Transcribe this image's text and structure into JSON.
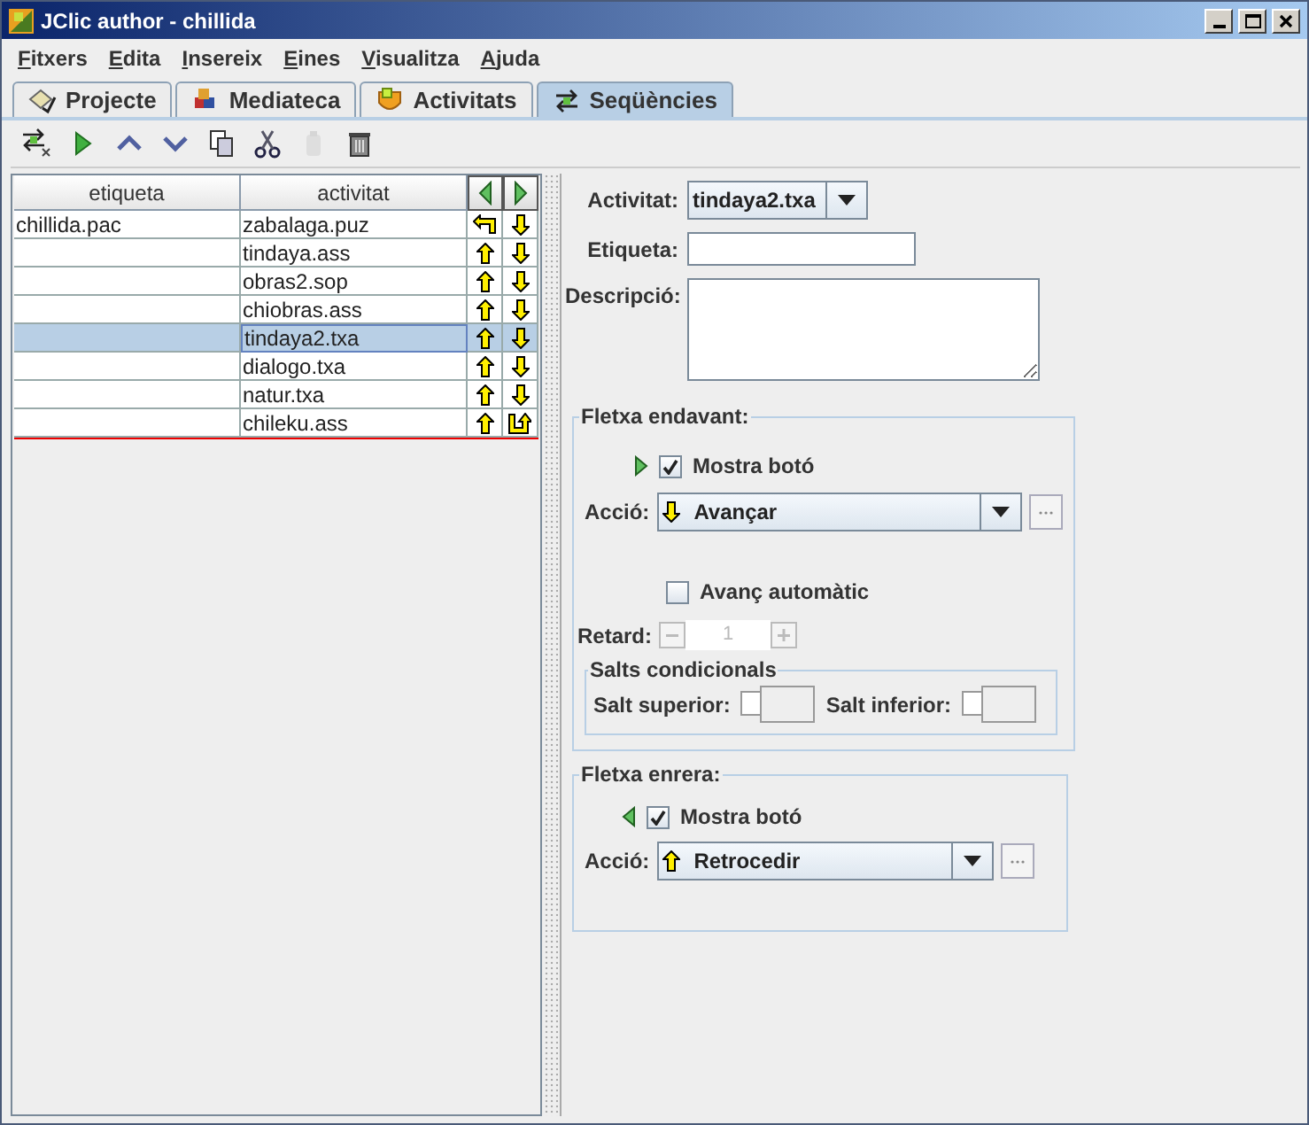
{
  "window": {
    "title": "JClic author - chillida"
  },
  "menu": [
    "Fitxers",
    "Edita",
    "Insereix",
    "Eines",
    "Visualitza",
    "Ajuda"
  ],
  "tabs": [
    {
      "label": "Projecte",
      "selected": false
    },
    {
      "label": "Mediateca",
      "selected": false
    },
    {
      "label": "Activitats",
      "selected": false
    },
    {
      "label": "Seqüències",
      "selected": true
    }
  ],
  "toolbar": [
    {
      "disabled": false
    },
    {
      "disabled": false
    },
    {
      "disabled": false
    },
    {
      "disabled": false
    },
    {
      "disabled": false
    },
    {
      "disabled": false
    },
    {
      "disabled": true
    },
    {
      "disabled": false
    }
  ],
  "table": {
    "columns": [
      "etiqueta",
      "activitat"
    ],
    "rows": [
      {
        "label": "chillida.pac",
        "activity": "zabalaga.puz",
        "back": {
          "kind": "return"
        },
        "forward": {
          "kind": "down"
        },
        "selected": false
      },
      {
        "activity": "tindaya.ass",
        "back": {
          "kind": "up"
        },
        "forward": {
          "kind": "down"
        },
        "selected": false
      },
      {
        "activity": "obras2.sop",
        "back": {
          "kind": "up"
        },
        "forward": {
          "kind": "down"
        },
        "selected": false
      },
      {
        "activity": "chiobras.ass",
        "back": {
          "kind": "up"
        },
        "forward": {
          "kind": "down"
        },
        "selected": false
      },
      {
        "activity": "tindaya2.txa",
        "back": {
          "kind": "up"
        },
        "forward": {
          "kind": "down"
        },
        "selected": true
      },
      {
        "activity": "dialogo.txa",
        "back": {
          "kind": "up"
        },
        "forward": {
          "kind": "down"
        },
        "selected": false
      },
      {
        "activity": "natur.txa",
        "back": {
          "kind": "up"
        },
        "forward": {
          "kind": "down"
        },
        "selected": false
      },
      {
        "activity": "chileku.ass",
        "back": {
          "kind": "up"
        },
        "forward": {
          "kind": "exit"
        },
        "selected": false
      }
    ]
  },
  "form": {
    "activity_label": "Activitat:",
    "activity": "tindaya2.txa",
    "tag_label": "Etiqueta:",
    "description_label": "Descripció:",
    "forward": {
      "title": "Fletxa endavant:",
      "show_label": "Mostra botó",
      "show_checked": true,
      "action_label": "Acció:",
      "action": "Avançar",
      "action_icon": {
        "kind": "down"
      },
      "auto_label": "Avanç automàtic",
      "auto_checked": false,
      "delay_label": "Retard:",
      "delay": "1",
      "delay_disabled": true,
      "jumps_title": "Salts condicionals",
      "upper_label": "Salt superior:",
      "lower_label": "Salt inferior:"
    },
    "backward": {
      "title": "Fletxa enrera:",
      "show_label": "Mostra botó",
      "show_checked": true,
      "action_label": "Acció:",
      "action": "Retrocedir",
      "action_icon": {
        "kind": "up"
      }
    }
  }
}
